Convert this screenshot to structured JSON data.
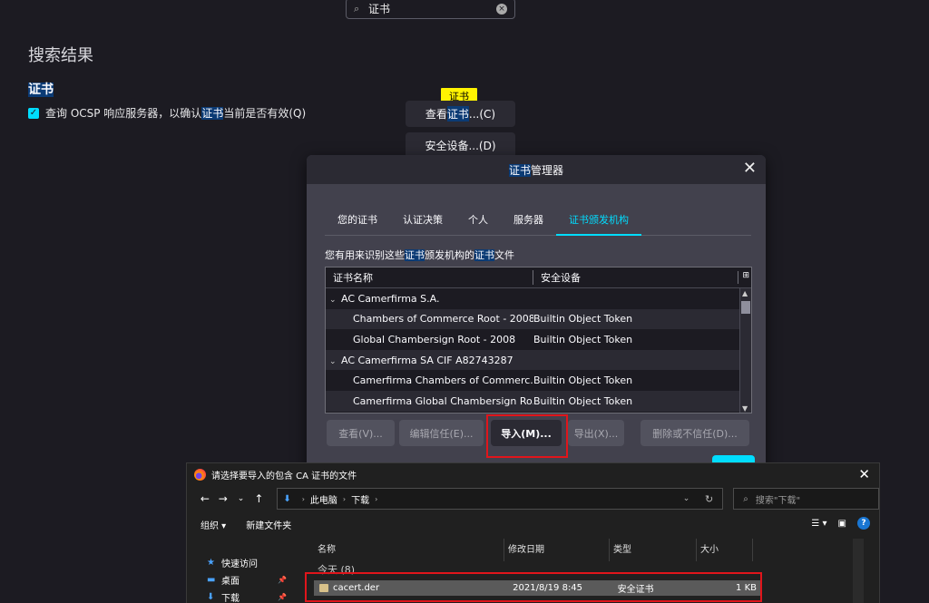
{
  "search": {
    "value": "证书",
    "clear_glyph": "×"
  },
  "results_title": "搜索结果",
  "section": {
    "heading": "证书",
    "ocsp_check_mark": "✓",
    "ocsp_label_pre": "查询 OCSP 响应服务器，以确认",
    "ocsp_label_hl": "证书",
    "ocsp_label_post": "当前是否有效(Q)"
  },
  "tooltip": "证书",
  "buttons": {
    "view_pre": "查看",
    "view_hl": "证书",
    "view_post": "...(C)",
    "devices": "安全设备...(D)"
  },
  "dialog": {
    "title_hl": "证书",
    "title_rest": "管理器",
    "close_glyph": "✕",
    "tabs": [
      {
        "label": "您的证书"
      },
      {
        "label": "认证决策"
      },
      {
        "label": "个人"
      },
      {
        "label": "服务器"
      },
      {
        "label": "证书颁发机构"
      }
    ],
    "intro_a": "您有用来识别这些",
    "intro_b": "证书",
    "intro_c": "颁发机构的",
    "intro_d": "证书",
    "intro_e": "文件",
    "columns": {
      "name": "证书名称",
      "device": "安全设备",
      "picker": "⊞"
    },
    "rows": [
      {
        "name": "AC Camerfirma S.A.",
        "device": ""
      },
      {
        "name": "Chambers of Commerce Root - 2008",
        "device": "Builtin Object Token"
      },
      {
        "name": "Global Chambersign Root - 2008",
        "device": "Builtin Object Token"
      },
      {
        "name": "AC Camerfirma SA CIF A82743287",
        "device": ""
      },
      {
        "name": "Camerfirma Chambers of Commerc...",
        "device": "Builtin Object Token"
      },
      {
        "name": "Camerfirma Global Chambersign Ro...",
        "device": "Builtin Object Token"
      }
    ],
    "actions": {
      "view": "查看(V)...",
      "edit": "编辑信任(E)...",
      "import": "导入(M)...",
      "export": "导出(X)...",
      "delete": "删除或不信任(D)..."
    }
  },
  "file_dialog": {
    "title": "请选择要导入的包含 CA 证书的文件",
    "close_glyph": "✕",
    "nav": {
      "back": "←",
      "forward": "→",
      "recent": "⌄",
      "up": "↑"
    },
    "path": [
      "此电脑",
      "下载"
    ],
    "search_placeholder": "搜索\"下载\"",
    "toolbar": {
      "organize": "组织 ▾",
      "new_folder": "新建文件夹"
    },
    "sidebar": [
      {
        "label": "快速访问",
        "icon": "star-icon"
      },
      {
        "label": "桌面",
        "icon": "desktop-icon"
      },
      {
        "label": "下载",
        "icon": "download-icon"
      }
    ],
    "columns": {
      "name": "名称",
      "date": "修改日期",
      "type": "类型",
      "size": "大小"
    },
    "group": "今天 (8)",
    "file": {
      "name": "cacert.der",
      "date": "2021/8/19 8:45",
      "type": "安全证书",
      "size": "1 KB"
    }
  },
  "colors": {
    "accent": "#00ddff",
    "highlight": "#0b3b75",
    "tooltip": "#fff301",
    "annotation_red": "#e0151b"
  }
}
